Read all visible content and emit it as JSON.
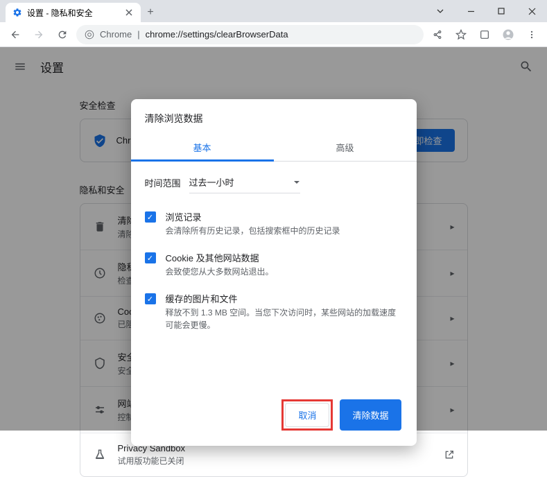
{
  "tab": {
    "title": "设置 - 隐私和安全"
  },
  "url": {
    "prefix": "Chrome",
    "path": "chrome://settings/clearBrowserData"
  },
  "header": {
    "title": "设置"
  },
  "sections": {
    "safety": {
      "title": "安全检查",
      "card_text": "Chro",
      "button": "立即检查"
    },
    "privacy": {
      "title": "隐私和安全",
      "rows": [
        {
          "title": "清除",
          "sub": "清除"
        },
        {
          "title": "隐私",
          "sub": "检查"
        },
        {
          "title": "Cook",
          "sub": "已阻"
        },
        {
          "title": "安全",
          "sub": "安全"
        },
        {
          "title": "网站",
          "sub": "控制"
        },
        {
          "title": "Privacy Sandbox",
          "sub": "试用版功能已关闭"
        }
      ]
    }
  },
  "dialog": {
    "title": "清除浏览数据",
    "tabs": {
      "basic": "基本",
      "advanced": "高级"
    },
    "time": {
      "label": "时间范围",
      "value": "过去一小时"
    },
    "items": [
      {
        "title": "浏览记录",
        "sub": "会清除所有历史记录，包括搜索框中的历史记录"
      },
      {
        "title": "Cookie 及其他网站数据",
        "sub": "会致使您从大多数网站退出。"
      },
      {
        "title": "缓存的图片和文件",
        "sub": "释放不到 1.3 MB 空间。当您下次访问时，某些网站的加载速度可能会更慢。"
      }
    ],
    "actions": {
      "cancel": "取消",
      "clear": "清除数据"
    }
  }
}
